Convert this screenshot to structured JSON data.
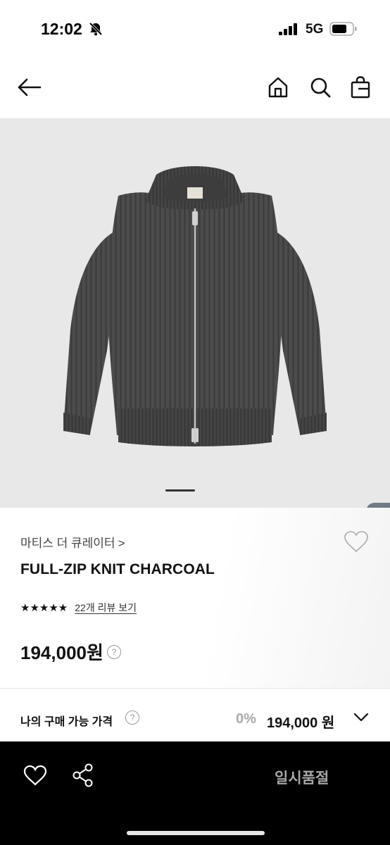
{
  "status_bar": {
    "time": "12:02",
    "network": "5G",
    "icons": [
      "silent-bell-icon",
      "signal-icon",
      "battery-icon"
    ]
  },
  "nav": {
    "icons": [
      "back-arrow-icon",
      "home-icon",
      "search-icon",
      "shopping-bag-icon"
    ]
  },
  "product": {
    "brand": "마티스 더 큐레이터",
    "brand_chevron": ">",
    "title": "FULL-ZIP KNIT CHARCOAL",
    "rating": 5,
    "stars": "★★★★★",
    "review_link": "22개 리뷰 보기",
    "price": "194,000원",
    "help_mark": "?"
  },
  "carousel": {
    "side_tab_glyph": "❮"
  },
  "purchase": {
    "label": "나의 구매 가능 가격",
    "help_mark": "?",
    "discount": "0%",
    "price": "194,000 원"
  },
  "bottom_bar": {
    "sold_out_label": "일시품절",
    "icons": [
      "heart-icon",
      "share-icon"
    ]
  },
  "colors": {
    "image_background": "#e8e8e8",
    "jacket": "#4a4a4a",
    "bottom_bar": "#000000",
    "sold_out_text": "#a7a7a7",
    "side_tab": "#6f7a84"
  }
}
